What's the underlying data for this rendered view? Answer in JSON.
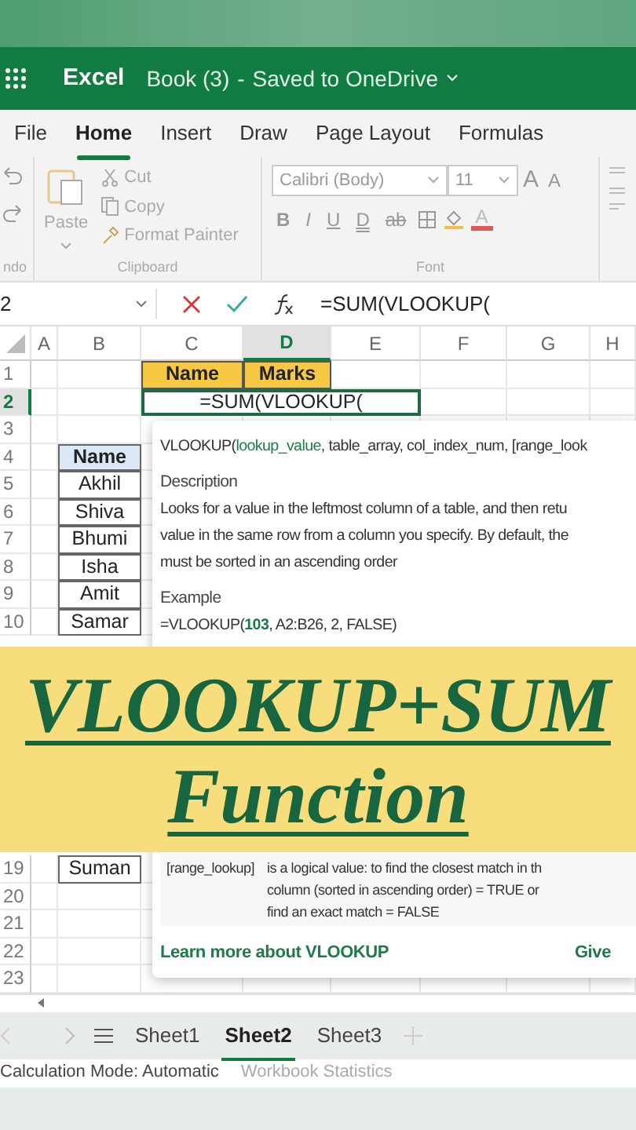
{
  "app_bar": {
    "app_name": "Excel",
    "document": "Book (3)",
    "separator": "-",
    "save_status": "Saved to OneDrive"
  },
  "tabs": [
    {
      "label": "File",
      "selected": false
    },
    {
      "label": "Home",
      "selected": true
    },
    {
      "label": "Insert",
      "selected": false
    },
    {
      "label": "Draw",
      "selected": false
    },
    {
      "label": "Page Layout",
      "selected": false
    },
    {
      "label": "Formulas",
      "selected": false
    }
  ],
  "ribbon": {
    "undo_group_label": "ndo",
    "clipboard": {
      "paste": {
        "label": "Paste",
        "disabled": true
      },
      "items": [
        {
          "label": "Cut",
          "kind": "cut",
          "disabled": true
        },
        {
          "label": "Copy",
          "kind": "copy",
          "disabled": true
        },
        {
          "label": "Format Painter",
          "kind": "painter",
          "disabled": true
        }
      ],
      "group_label": "Clipboard"
    },
    "font": {
      "font_name": "Calibri (Body)",
      "font_size": "11",
      "size_buttons": [
        "A",
        "A"
      ],
      "format_buttons": [
        {
          "label": "B",
          "kind": "bold"
        },
        {
          "label": "I",
          "kind": "italic"
        },
        {
          "label": "U",
          "kind": "underline"
        },
        {
          "label": "D",
          "kind": "double"
        },
        {
          "label": "ab",
          "kind": "strike"
        }
      ],
      "font_color": "A",
      "group_label": "Font"
    }
  },
  "formula_bar": {
    "name_box": "2",
    "formula": "=SUM(VLOOKUP("
  },
  "columns": [
    {
      "label": "A",
      "selected": false
    },
    {
      "label": "B",
      "selected": false
    },
    {
      "label": "C",
      "selected": false
    },
    {
      "label": "D",
      "selected": true
    },
    {
      "label": "E",
      "selected": false
    },
    {
      "label": "F",
      "selected": false
    },
    {
      "label": "G",
      "selected": false
    },
    {
      "label": "H",
      "selected": false
    }
  ],
  "rows_top": [
    {
      "number": "1",
      "selected": false,
      "c": {
        "text": "Name",
        "kind": "yellow_header"
      },
      "d": {
        "text": "Marks",
        "kind": "yellow_header"
      }
    },
    {
      "number": "2",
      "selected": true,
      "editing": {
        "text": "=SUM(VLOOKUP("
      }
    },
    {
      "number": "3",
      "selected": false
    },
    {
      "number": "4",
      "selected": false,
      "b": {
        "text": "Name",
        "kind": "blue_header"
      }
    },
    {
      "number": "5",
      "selected": false,
      "b": {
        "text": "Akhil",
        "kind": "plain"
      }
    },
    {
      "number": "6",
      "selected": false,
      "b": {
        "text": "Shiva",
        "kind": "plain"
      }
    },
    {
      "number": "7",
      "selected": false,
      "b": {
        "text": "Bhumi",
        "kind": "plain"
      }
    },
    {
      "number": "8",
      "selected": false,
      "b": {
        "text": "Isha",
        "kind": "plain"
      }
    },
    {
      "number": "9",
      "selected": false,
      "b": {
        "text": "Amit",
        "kind": "plain"
      }
    },
    {
      "number": "10",
      "selected": false,
      "b": {
        "text": "Samar",
        "kind": "plain"
      }
    }
  ],
  "rows_bottom": [
    {
      "number": "19",
      "selected": false,
      "b": {
        "text": "Suman",
        "kind": "plain"
      }
    },
    {
      "number": "20",
      "selected": false
    },
    {
      "number": "21",
      "selected": false
    },
    {
      "number": "22",
      "selected": false
    },
    {
      "number": "23",
      "selected": false
    }
  ],
  "tooltip": {
    "signature": {
      "function": "VLOOKUP(",
      "current_argument": "lookup_value",
      "rest": ", table_array, col_index_num, [range_look"
    },
    "description_heading": "Description",
    "description_lines": [
      "Looks for a value in the leftmost column of a table, and then retu",
      "value in the same row from a column you specify. By default, the",
      "must be sorted in an ascending order"
    ],
    "example_heading": "Example",
    "example": {
      "start": "=VLOOKUP(",
      "highlight": "103",
      "end": ", A2:B26, 2, FALSE)"
    },
    "argument": {
      "name": "[range_lookup]",
      "lines": [
        "is a logical value: to find the closest match in th",
        "column (sorted in ascending order) = TRUE or",
        "find an exact match = FALSE"
      ]
    },
    "learn_more": "Learn more about VLOOKUP",
    "feedback": "Give"
  },
  "banner": {
    "title": "VLOOKUP+SUM",
    "subtitle": "Function"
  },
  "sheet_tabs": [
    {
      "label": "Sheet1",
      "selected": false
    },
    {
      "label": "Sheet2",
      "selected": true
    },
    {
      "label": "Sheet3",
      "selected": false
    }
  ],
  "status_bar": {
    "mode": "Calculation Mode: Automatic",
    "statistics": {
      "label": "Workbook Statistics",
      "disabled": true
    }
  }
}
